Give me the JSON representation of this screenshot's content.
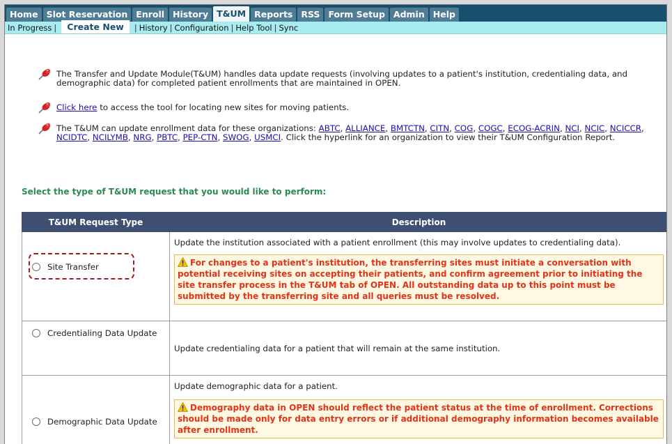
{
  "nav": {
    "tabs": [
      "Home",
      "Slot Reservation",
      "Enroll",
      "History",
      "T&UM",
      "Reports",
      "RSS",
      "Form Setup",
      "Admin",
      "Help"
    ],
    "active_tab": "T&UM"
  },
  "subnav": {
    "items": [
      "In Progress",
      "Create New",
      "History",
      "Configuration",
      "Help Tool",
      "Sync"
    ],
    "active": "Create New"
  },
  "intro": {
    "bullet1": "The Transfer and Update Module(T&UM) handles data update requests (involving updates to a patient's institution, credentialing data, and demographic data) for completed patient enrollments that are maintained in OPEN.",
    "bullet2_link": "Click here",
    "bullet2_rest": " to access the tool for locating new sites for moving patients.",
    "bullet3_prefix": "The T&UM can update enrollment data for these organizations: ",
    "organizations": [
      "ABTC",
      "ALLIANCE",
      "BMTCTN",
      "CITN",
      "COG",
      "COGC",
      "ECOG-ACRIN",
      "NCI",
      "NCIC",
      "NCICCR",
      "NCIDTC",
      "NCILYMB",
      "NRG",
      "PBTC",
      "PEP-CTN",
      "SWOG",
      "USMCI"
    ],
    "bullet3_suffix": ". Click the hyperlink for an organization to view their T&UM Configuration Report."
  },
  "prompt": "Select the type of T&UM request that you would like to perform:",
  "table": {
    "headers": [
      "T&UM Request Type",
      "Description"
    ],
    "rows": [
      {
        "type": "Site Transfer",
        "description": "Update the institution associated with a patient enrollment (this may involve updates to credentialing data).",
        "warning": "For changes to a patient's institution, the transferring sites must initiate a conversation with potential receiving sites on accepting their patients, and confirm agreement prior to initiating the site transfer process in the T&UM tab of OPEN. All outstanding data up to this point must be submitted by the transferring site and all queries must be resolved."
      },
      {
        "type": "Credentialing Data Update",
        "description": "Update credentialing data for a patient that will remain at the same institution.",
        "warning": ""
      },
      {
        "type": "Demographic Data Update",
        "description": "Update demographic data for a patient.",
        "warning": "Demography data in OPEN should reflect the patient status at the time of enrollment. Corrections should be made only for data entry errors or if additional demography information becomes available after enrollment."
      }
    ]
  },
  "colors": {
    "nav_bg": "#194f6e",
    "subnav_bg": "#a9ecf0",
    "table_header": "#3e4f72",
    "prompt_green": "#2d8a54",
    "warning_text": "#e0341a",
    "highlight_dash": "#a01a1a"
  },
  "icons": {
    "bullet": "pushpin-icon",
    "warning": "warning-triangle-icon"
  }
}
